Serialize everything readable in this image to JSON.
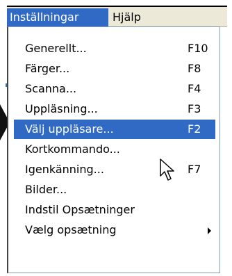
{
  "menubar": {
    "items": [
      {
        "label": "Inställningar",
        "active": true
      },
      {
        "label": "Hjälp",
        "active": false
      }
    ]
  },
  "dropdown": {
    "items": [
      {
        "label": "Generellt...",
        "shortcut": "F10"
      },
      {
        "label": "Färger...",
        "shortcut": "F8"
      },
      {
        "label": "Scanna...",
        "shortcut": "F4"
      },
      {
        "label": "Uppläsning...",
        "shortcut": "F3"
      },
      {
        "label": "Välj uppläsare...",
        "shortcut": "F2",
        "selected": true
      },
      {
        "label": "Kortkommando...",
        "shortcut": ""
      },
      {
        "label": "Igenkänning...",
        "shortcut": "F7"
      },
      {
        "label": "Bilder...",
        "shortcut": ""
      },
      {
        "label": "Indstil Opsætninger",
        "shortcut": ""
      },
      {
        "label": "Vælg opsætning",
        "shortcut": "",
        "has_submenu": true
      }
    ]
  },
  "colors": {
    "highlight": "#316ac5",
    "menubar_bg": "#ece9d8",
    "menu_bg": "#ffffff"
  },
  "icons": [
    "pointer-cursor-icon",
    "submenu-arrow-icon"
  ]
}
